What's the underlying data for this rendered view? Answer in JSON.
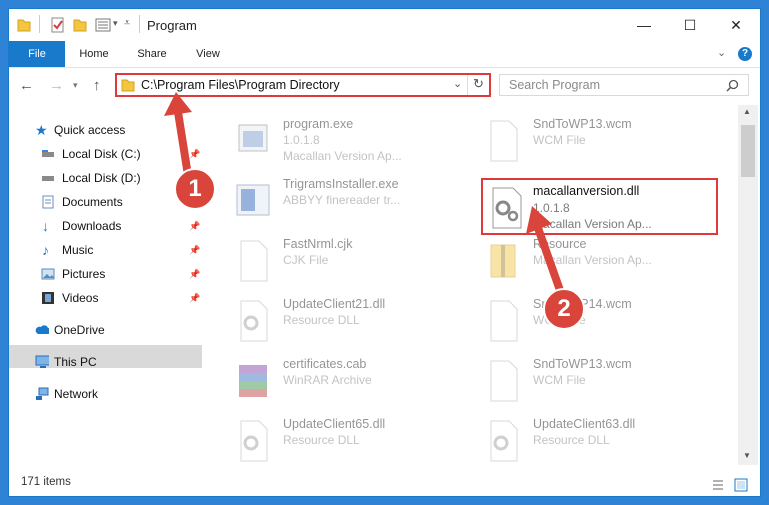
{
  "window": {
    "title": "Program"
  },
  "titlebar": {
    "minimize": "—",
    "maximize": "☐",
    "close": "✕"
  },
  "ribbon": {
    "tabs": [
      "File",
      "Home",
      "Share",
      "View"
    ]
  },
  "nav": {
    "back": "←",
    "forward": "→",
    "up": "↑"
  },
  "address": {
    "path": "C:\\Program Files\\Program Directory"
  },
  "search": {
    "placeholder": "Search Program"
  },
  "sidebar": {
    "items": [
      {
        "label": "Quick access",
        "icon": "star-icon",
        "pinned": false
      },
      {
        "label": "Local Disk (C:)",
        "icon": "drive-icon",
        "pinned": true
      },
      {
        "label": "Local Disk (D:)",
        "icon": "drive-icon",
        "pinned": true
      },
      {
        "label": "Documents",
        "icon": "documents-icon",
        "pinned": true
      },
      {
        "label": "Downloads",
        "icon": "download-icon",
        "pinned": true
      },
      {
        "label": "Music",
        "icon": "music-icon",
        "pinned": true
      },
      {
        "label": "Pictures",
        "icon": "pictures-icon",
        "pinned": true
      },
      {
        "label": "Videos",
        "icon": "videos-icon",
        "pinned": true
      },
      {
        "label": "OneDrive",
        "icon": "cloud-icon",
        "pinned": false
      },
      {
        "label": "This PC",
        "icon": "computer-icon",
        "pinned": false
      },
      {
        "label": "Network",
        "icon": "network-icon",
        "pinned": false
      }
    ]
  },
  "files": [
    {
      "name": "program.exe",
      "line2": "1.0.1.8",
      "line3": "Macallan Version Ap...",
      "icon": "exe-icon"
    },
    {
      "name": "SndToWP13.wcm",
      "line2": "WCM File",
      "line3": "",
      "icon": "file-icon"
    },
    {
      "name": "TrigramsInstaller.exe",
      "line2": "ABBYY finereader tr...",
      "line3": "",
      "icon": "installer-icon"
    },
    {
      "name": "macallanversion.dll",
      "line2": "1.0.1.8",
      "line3": "Macallan Version Ap...",
      "icon": "dll-gear-icon"
    },
    {
      "name": "FastNrml.cjk",
      "line2": "CJK File",
      "line3": "",
      "icon": "file-icon"
    },
    {
      "name": "Resource",
      "line2": "Macallan Version Ap...",
      "line3": "",
      "icon": "archive-icon"
    },
    {
      "name": "UpdateClient21.dll",
      "line2": "Resource DLL",
      "line3": "",
      "icon": "dll-gear-icon"
    },
    {
      "name": "SndToWP14.wcm",
      "line2": "WCM File",
      "line3": "",
      "icon": "file-icon"
    },
    {
      "name": "certificates.cab",
      "line2": "WinRAR Archive",
      "line3": "",
      "icon": "winrar-icon"
    },
    {
      "name": "SndToWP13.wcm",
      "line2": "WCM File",
      "line3": "",
      "icon": "file-icon"
    },
    {
      "name": "UpdateClient65.dll",
      "line2": "Resource DLL",
      "line3": "",
      "icon": "dll-gear-icon"
    },
    {
      "name": "UpdateClient63.dll",
      "line2": "Resource DLL",
      "line3": "",
      "icon": "dll-gear-icon"
    }
  ],
  "status": {
    "item_count": "171 items"
  },
  "annotations": {
    "step1": "1",
    "step2": "2"
  },
  "colors": {
    "accent": "#1979ca",
    "highlight_border": "#e0393b",
    "badge": "#d9453a",
    "selection": "#d9d9d9"
  }
}
